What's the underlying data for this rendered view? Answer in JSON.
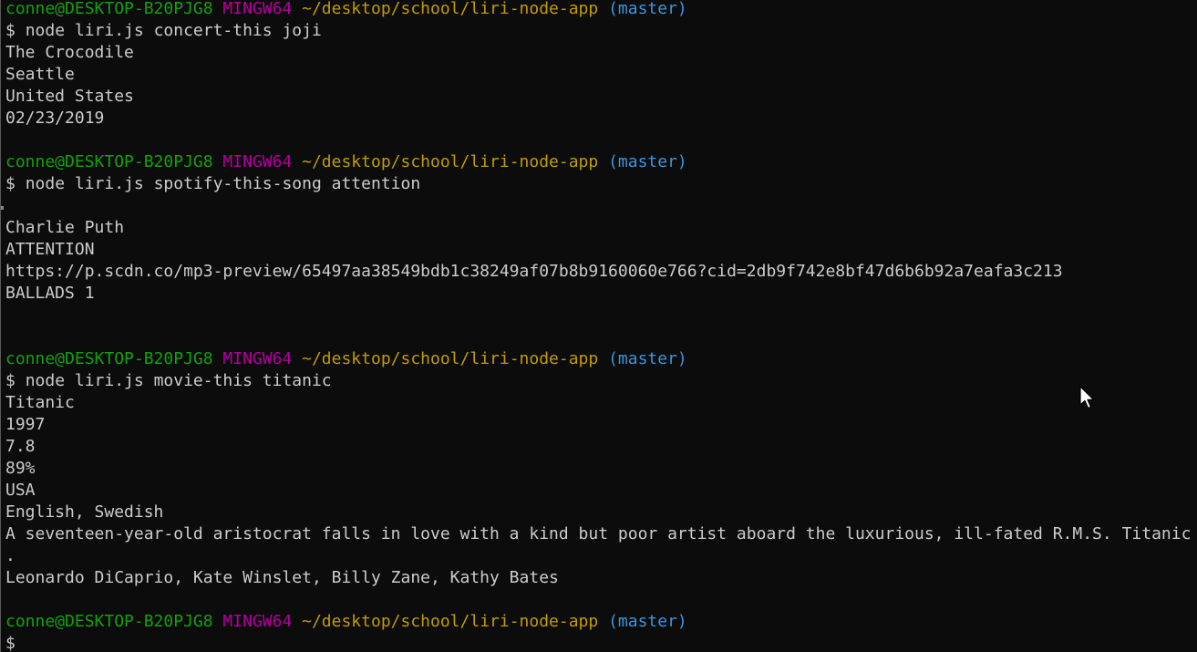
{
  "prompt": {
    "user_host": "conne@DESKTOP-B20PJG8",
    "system": "MINGW64",
    "path": "~/desktop/school/liri-node-app",
    "branch": "(master)",
    "symbol": "$"
  },
  "sessions": [
    {
      "command": "node liri.js concert-this joji",
      "output": [
        "The Crocodile",
        "Seattle",
        "United States",
        "02/23/2019",
        ""
      ]
    },
    {
      "command": "node liri.js spotify-this-song attention",
      "output": [
        "",
        "Charlie Puth",
        "ATTENTION",
        "https://p.scdn.co/mp3-preview/65497aa38549bdb1c38249af07b8b9160060e766?cid=2db9f742e8bf47d6b6b92a7eafa3c213",
        "BALLADS 1",
        "",
        ""
      ]
    },
    {
      "command": "node liri.js movie-this titanic",
      "output": [
        "Titanic",
        "1997",
        "7.8",
        "89%",
        "USA",
        "English, Swedish",
        "A seventeen-year-old aristocrat falls in love with a kind but poor artist aboard the luxurious, ill-fated R.M.S. Titanic",
        ".",
        "Leonardo DiCaprio, Kate Winslet, Billy Zane, Kathy Bates",
        ""
      ]
    }
  ],
  "current_input": "",
  "colors": {
    "background": "#0c0c0c",
    "text": "#cccccc",
    "user_host": "#13a10e",
    "system": "#b4009e",
    "path": "#c19c00",
    "branch": "#3a96dd"
  },
  "icons": {
    "pointer": "mouse-pointer-icon"
  }
}
